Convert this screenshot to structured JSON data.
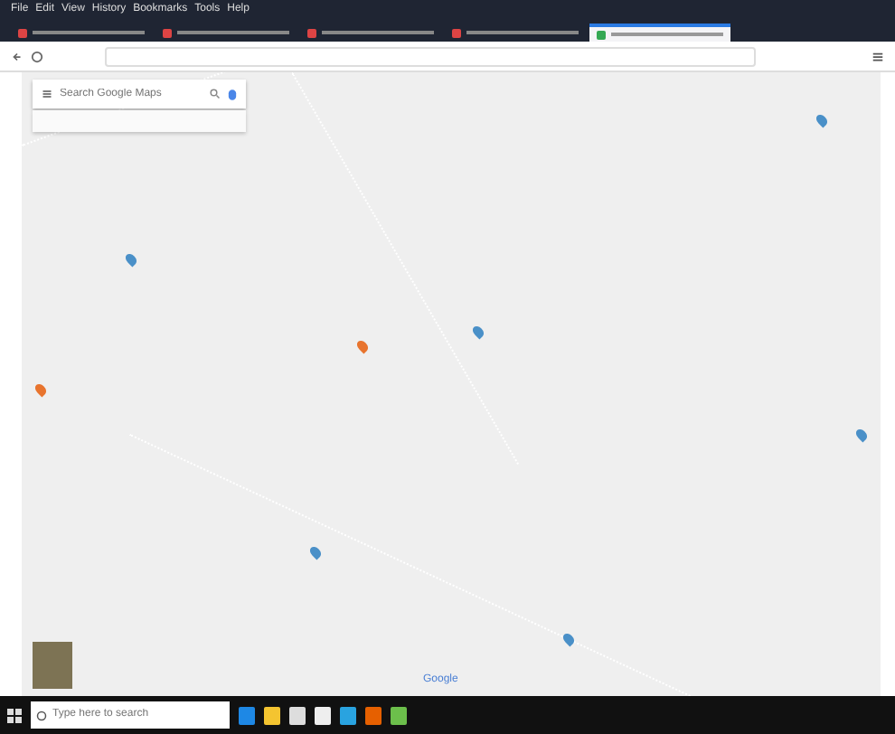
{
  "menu": [
    "File",
    "Edit",
    "View",
    "History",
    "Bookmarks",
    "Tools",
    "Help"
  ],
  "tabs": [
    {
      "selected": false
    },
    {
      "selected": false
    },
    {
      "selected": false
    },
    {
      "selected": false
    },
    {
      "selected": true
    }
  ],
  "search": {
    "placeholder": "Search Google Maps"
  },
  "pins": [
    {
      "color": "#4a90c8"
    },
    {
      "color": "#e8742e"
    },
    {
      "color": "#e8742e"
    },
    {
      "color": "#4a90c8"
    },
    {
      "color": "#4a90c8"
    },
    {
      "color": "#4a90c8"
    },
    {
      "color": "#4a90c8"
    },
    {
      "color": "#4a90c8"
    }
  ],
  "logo": "Google",
  "taskbar": {
    "placeholder": "Type here to search"
  }
}
